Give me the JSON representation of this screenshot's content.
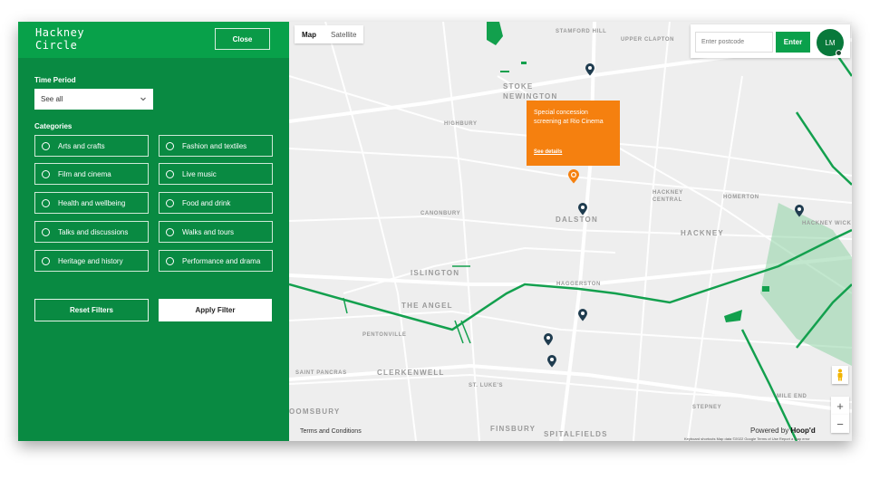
{
  "sidebar": {
    "brand": "Hackney Circle",
    "close_label": "Close",
    "time_period_label": "Time Period",
    "time_period_value": "See all",
    "categories_label": "Categories",
    "categories": [
      "Arts and crafts",
      "Fashion and textiles",
      "Film and cinema",
      "Live music",
      "Health and wellbeing",
      "Food and drink",
      "Talks and discussions",
      "Walks and tours",
      "Heritage and history",
      "Performance and drama"
    ],
    "reset_label": "Reset Filters",
    "apply_label": "Apply Filter"
  },
  "map": {
    "view_tabs": [
      "Map",
      "Satellite"
    ],
    "active_view": "Map",
    "postcode_placeholder": "Enter postcode",
    "enter_label": "Enter",
    "avatar_initials": "LM",
    "popup": {
      "text": "Special concession screening at Rio Cinema",
      "link": "See details"
    },
    "labels": {
      "stamford_hill": "STAMFORD HILL",
      "upper_clapton": "UPPER CLAPTON",
      "stoke_newington": "STOKE NEWINGTON",
      "highbury": "HIGHBURY",
      "hackney_central": "HACKNEY CENTRAL",
      "homerton": "HOMERTON",
      "hackney_wick": "HACKNEY WICK",
      "canonbury": "CANONBURY",
      "dalston": "DALSTON",
      "hackney": "HACKNEY",
      "islington": "ISLINGTON",
      "haggerston": "HAGGERSTON",
      "the_angel": "THE ANGEL",
      "pentonville": "PENTONVILLE",
      "st_pancras": "SAINT PANCRAS",
      "clerkenwell": "CLERKENWELL",
      "st_lukes": "ST. LUKE'S",
      "stepney": "STEPNEY",
      "mile_end": "MILE END",
      "finsbury": "FINSBURY",
      "spitalfields": "SPITALFIELDS",
      "bloomsbury": "OOMSBURY"
    },
    "terms": "Terms and Conditions",
    "powered_prefix": "Powered by",
    "powered_brand": "Hoop'd",
    "attribution": "Keyboard shortcuts   Map data ©2022 Google   Terms of Use   Report a map error",
    "zoom_in": "+",
    "zoom_out": "−"
  },
  "colors": {
    "sidebar_bg": "#098a42",
    "header_bg": "#08a14a",
    "popup": "#f5800f",
    "marker": "#1f3c4f",
    "route": "#13a04e"
  }
}
